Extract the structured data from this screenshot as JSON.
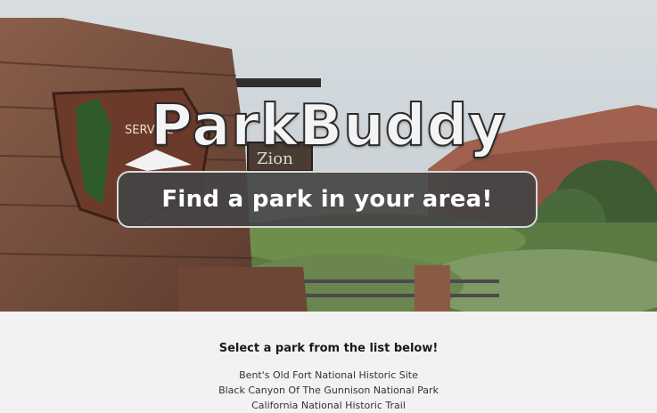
{
  "header": {
    "brand": "ParkBuddy",
    "tagline": "Find a park in your area!"
  },
  "hero": {
    "sign_emblem_text": "SERVICE",
    "sign_text": "Zion"
  },
  "main": {
    "prompt": "Select a park from the list below!",
    "parks": [
      "Bent's Old Fort National Historic Site",
      "Black Canyon Of The Gunnison National Park",
      "California National Historic Trail"
    ]
  },
  "colors": {
    "cta_background": "#444444",
    "cta_border": "#d9d9d9",
    "page_background": "#f2f2f2"
  }
}
